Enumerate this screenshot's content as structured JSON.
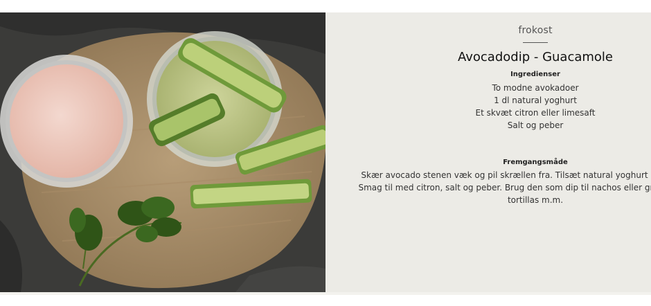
{
  "recipe": {
    "category": "frokost",
    "title": "Avocadodip - Guacamole",
    "ingredients_heading": "Ingredienser",
    "ingredients": [
      "To modne avokadoer",
      "1 dl natural yoghurt",
      "Et skvæt citron eller limesaft",
      "Salt og peber"
    ],
    "method_heading": "Fremgangsmåde",
    "method_lines": [
      "Skær avocado stenen væk og pil skrællen fra. Tilsæt natural yoghurt og blend ellen",
      "Smag til med citron, salt og peber. Brug den som dip til nachos eller grøntsagsstæng",
      "tortillas m.m."
    ]
  },
  "colors": {
    "panel_background": "#ecebe6",
    "text": "#333333",
    "title": "#111111"
  }
}
